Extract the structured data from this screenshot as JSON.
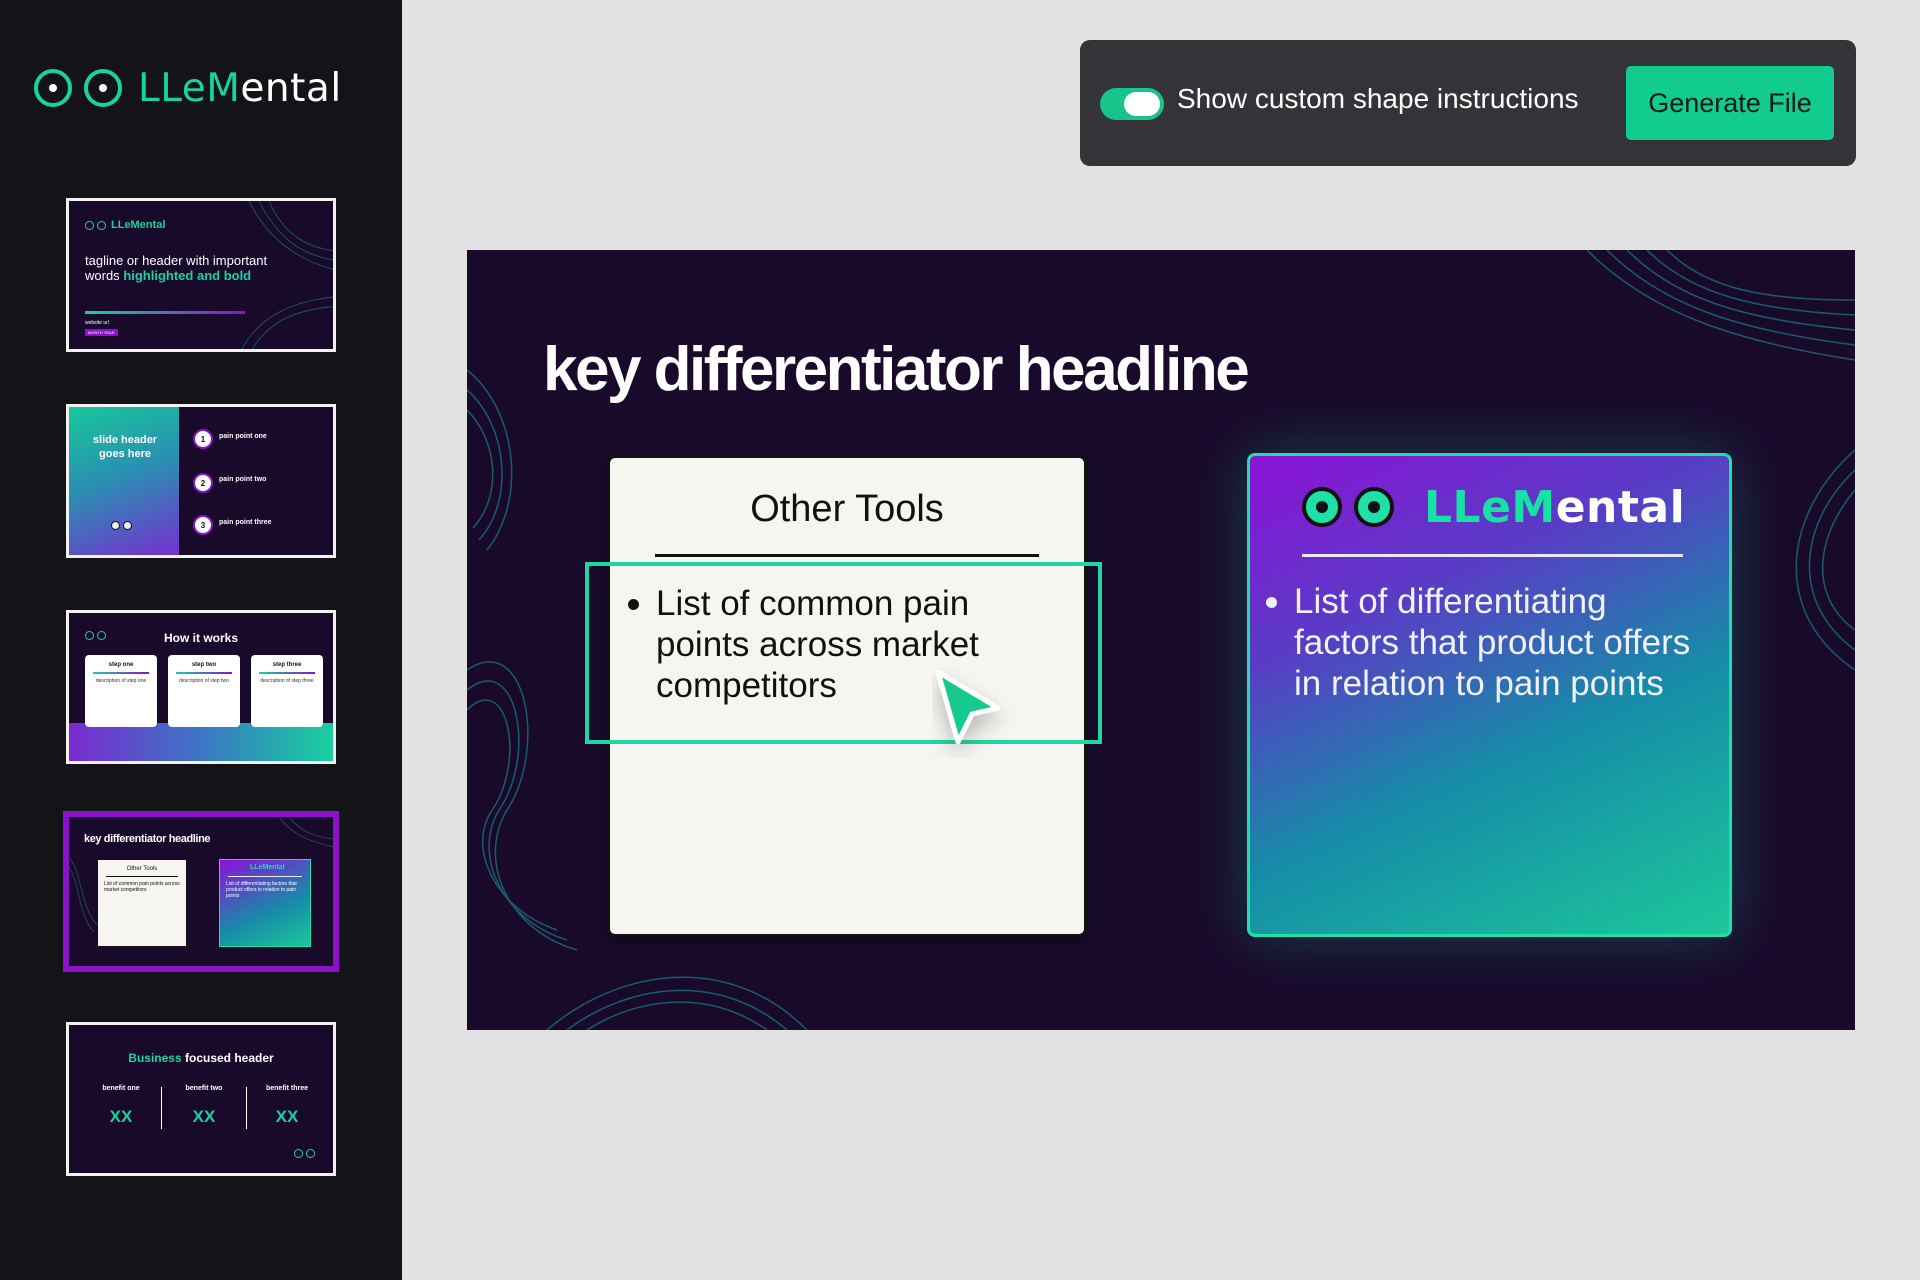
{
  "app": {
    "brand_prefix": "LLe",
    "brand_mid": "M",
    "brand_suffix": "ental",
    "accent_color": "#17d49c",
    "selection_color": "#8a12c9"
  },
  "toolbar": {
    "toggle_label": "Show custom shape instructions",
    "toggle_on": true,
    "generate_label": "Generate File"
  },
  "thumbnails": [
    {
      "brand": "LLeMental",
      "tagline_plain": "tagline or header with important words",
      "tagline_bold": "highlighted and bold",
      "url": "website url",
      "date": "MONTH YEAR"
    },
    {
      "header": "slide header goes here",
      "points": [
        "pain point one",
        "pain point two",
        "pain point three"
      ],
      "numbers": [
        "1",
        "2",
        "3"
      ]
    },
    {
      "title": "How it works",
      "steps": [
        {
          "title": "step one",
          "desc": "description of step one"
        },
        {
          "title": "step two",
          "desc": "description of step two"
        },
        {
          "title": "step three",
          "desc": "description of step three"
        }
      ]
    },
    {
      "title": "key differentiator headline",
      "left_title": "Other Tools",
      "left_text": "List of common pain points across market competitors",
      "right_brand": "LLeMental",
      "right_text": "List of differentiating factors that product offers in relation to pain points",
      "selected": true
    },
    {
      "title_accent": "Business",
      "title_rest": "focused header",
      "benefits": [
        {
          "label": "benefit one",
          "value": "XX"
        },
        {
          "label": "benefit two",
          "value": "XX"
        },
        {
          "label": "benefit three",
          "value": "XX"
        }
      ]
    }
  ],
  "slide": {
    "headline": "key differentiator headline",
    "left_card": {
      "title": "Other Tools",
      "bullet": "List of common pain points across market competitors"
    },
    "right_card": {
      "brand_prefix": "LLe",
      "brand_mid": "M",
      "brand_suffix": "ental",
      "bullet": "List of differentiating factors that product offers in relation to pain points"
    }
  }
}
